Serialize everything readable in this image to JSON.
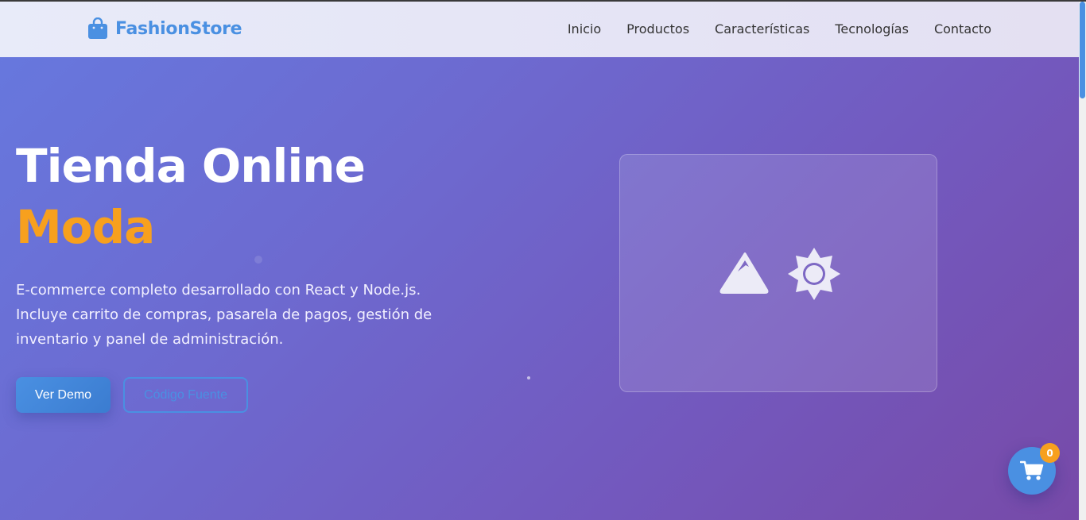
{
  "brand": {
    "name": "FashionStore",
    "icon": "shopping-bag-icon",
    "color": "#4a90e2"
  },
  "nav": {
    "items": [
      {
        "label": "Inicio"
      },
      {
        "label": "Productos"
      },
      {
        "label": "Características"
      },
      {
        "label": "Tecnologías"
      },
      {
        "label": "Contacto"
      }
    ]
  },
  "hero": {
    "title_line1": "Tienda Online",
    "title_line2": "Moda",
    "title_accent_color": "#f7a01e",
    "description": "E-commerce completo desarrollado con React y Node.js. Incluye carrito de compras, pasarela de pagos, gestión de inventario y panel de administración.",
    "primary_button": "Ver Demo",
    "secondary_button": "Código Fuente",
    "image_icons": [
      "mountain-image-icon",
      "sun-icon"
    ]
  },
  "cart": {
    "count": "0",
    "icon": "shopping-cart-icon"
  }
}
